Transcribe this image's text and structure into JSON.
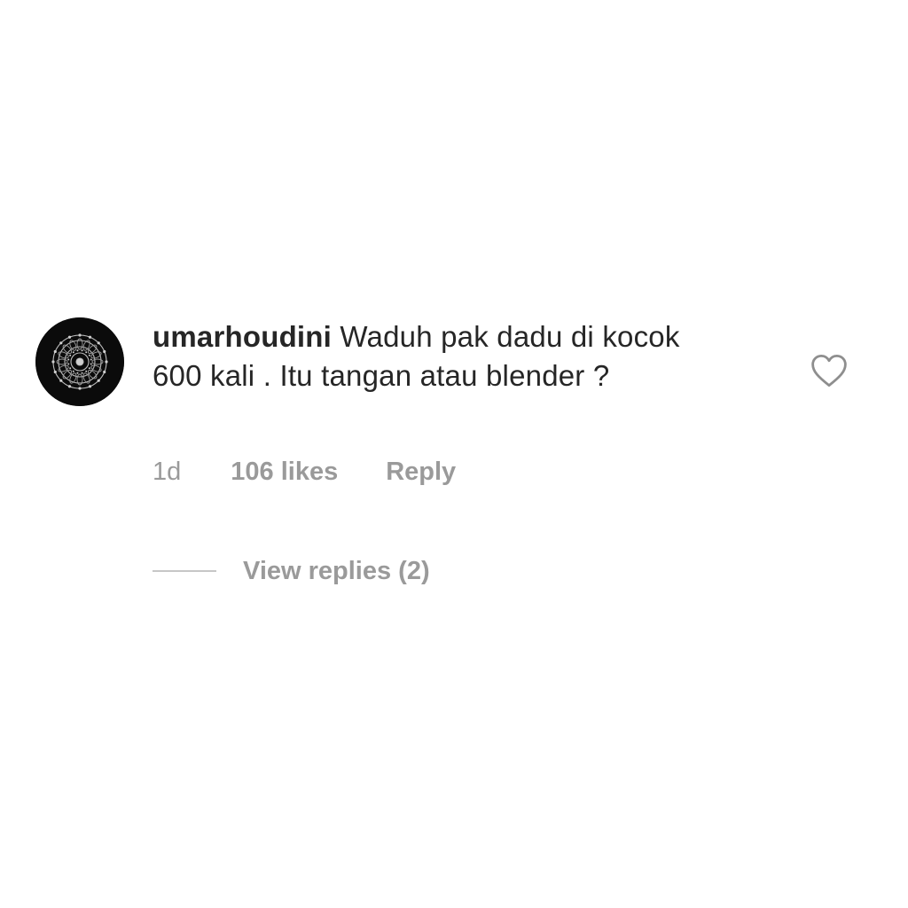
{
  "comment": {
    "username": "umarhoudini",
    "text": "Waduh pak dadu di kocok 600 kali . Itu tangan atau blender ?",
    "avatar_icon": "mandala-avatar-icon",
    "like_icon": "heart-outline-icon"
  },
  "meta": {
    "time": "1d",
    "likes": "106 likes",
    "reply_label": "Reply"
  },
  "replies": {
    "view_label": "View replies (2)"
  },
  "colors": {
    "text_primary": "#262626",
    "text_secondary": "#9a9a9a",
    "divider": "#c7c7c7",
    "avatar_bg": "#0b0b0b",
    "background": "#ffffff"
  }
}
